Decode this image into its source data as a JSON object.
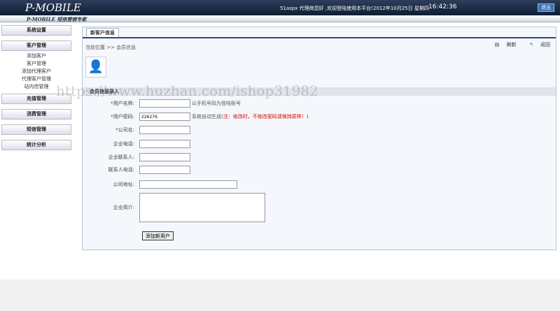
{
  "header": {
    "logo": "P-MOBILE",
    "slogan": "P-MOBILE 短信营销专家",
    "welcome": "51aspx 代理商您好  ,欢迎登陆使用本平台!",
    "date": "2012年10月25日 星期四",
    "time": "16:42:36",
    "logout": "退出"
  },
  "sidebar": {
    "system": "系统设置",
    "customer": "客户管理",
    "customer_items": [
      "添加客户",
      "客户管理",
      "添加代理客户",
      "代理客户管理",
      "站内信管理"
    ],
    "recharge": "充值管理",
    "consume": "消费管理",
    "sms": "短信管理",
    "stats": "统计分析"
  },
  "main": {
    "tab": "新客户信息",
    "breadcrumb": "当前位置 >> 会员信息",
    "refresh": "刷新",
    "back": "返回",
    "section": "会员信息录入",
    "fields": [
      {
        "label": "用户名称:",
        "required": true,
        "value": "",
        "note": "以手机号码为登陆账号"
      },
      {
        "label": "用户密码:",
        "required": true,
        "value": "226276",
        "note": "系统自动生成(",
        "note_warn": "注：修改时，不修改密码请保持原样！)"
      },
      {
        "label": "公司名:",
        "required": true,
        "value": ""
      },
      {
        "label": "企业电话:",
        "value": ""
      },
      {
        "label": "企业联系人:",
        "value": ""
      },
      {
        "label": "联系人电话:",
        "value": ""
      },
      {
        "label": "公司地址:",
        "value": ""
      },
      {
        "label": "企业简介:",
        "value": ""
      }
    ],
    "submit": "添加新用户"
  },
  "watermark": "https://www.huzhan.com/ishop31982"
}
